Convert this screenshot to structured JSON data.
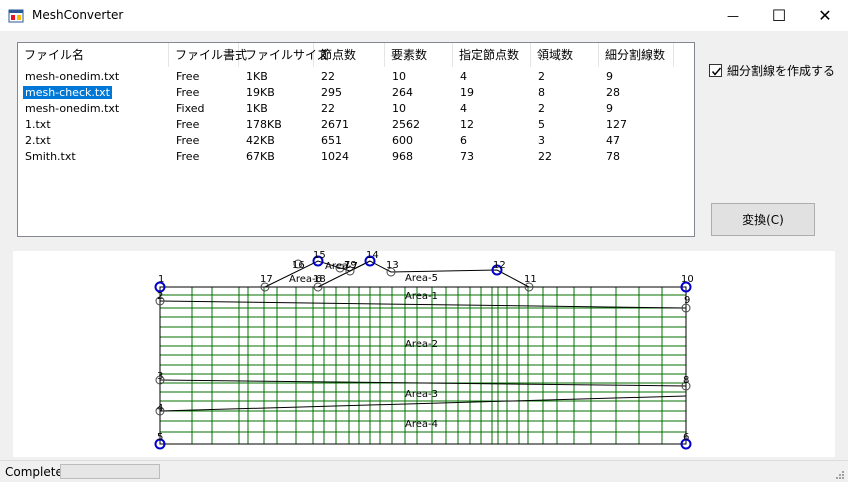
{
  "window": {
    "title": "MeshConverter",
    "minimize_glyph": "—",
    "maximize_glyph": "☐",
    "close_glyph": "✕"
  },
  "file_list": {
    "columns": [
      "ファイル名",
      "ファイル書式",
      "ファイルサイズ",
      "節点数",
      "要素数",
      "指定節点数",
      "領域数",
      "細分割線数"
    ],
    "rows": [
      [
        "mesh-onedim.txt",
        "Free",
        "1KB",
        "22",
        "10",
        "4",
        "2",
        "9"
      ],
      [
        "mesh-check.txt",
        "Free",
        "19KB",
        "295",
        "264",
        "19",
        "8",
        "28"
      ],
      [
        "mesh-onedim.txt",
        "Fixed",
        "1KB",
        "22",
        "10",
        "4",
        "2",
        "9"
      ],
      [
        "1.txt",
        "Free",
        "178KB",
        "2671",
        "2562",
        "12",
        "5",
        "127"
      ],
      [
        "2.txt",
        "Free",
        "42KB",
        "651",
        "600",
        "6",
        "3",
        "47"
      ],
      [
        "Smith.txt",
        "Free",
        "67KB",
        "1024",
        "968",
        "73",
        "22",
        "78"
      ]
    ],
    "selected_row": 1
  },
  "options": {
    "subdivide_checkbox_label": "細分割線を作成する",
    "subdivide_checked": true
  },
  "convert_button_label": "変換(C)",
  "mesh_view": {
    "node_labels": [
      "1",
      "17",
      "16",
      "15",
      "18",
      "19",
      "14",
      "7",
      "13",
      "12",
      "11",
      "10",
      "9",
      "3",
      "8",
      "4",
      "5",
      "6",
      "2"
    ],
    "area_labels": [
      "Area-1",
      "Area-2",
      "Area-3",
      "Area-4",
      "Area-5",
      "Area-6",
      "Area-7"
    ],
    "colors": {
      "grid": "#007000",
      "boundary": "#000000",
      "node_fixed": "#0000cc",
      "node_open": "#444444"
    }
  },
  "status": {
    "text": "Complete",
    "progress": 0
  }
}
